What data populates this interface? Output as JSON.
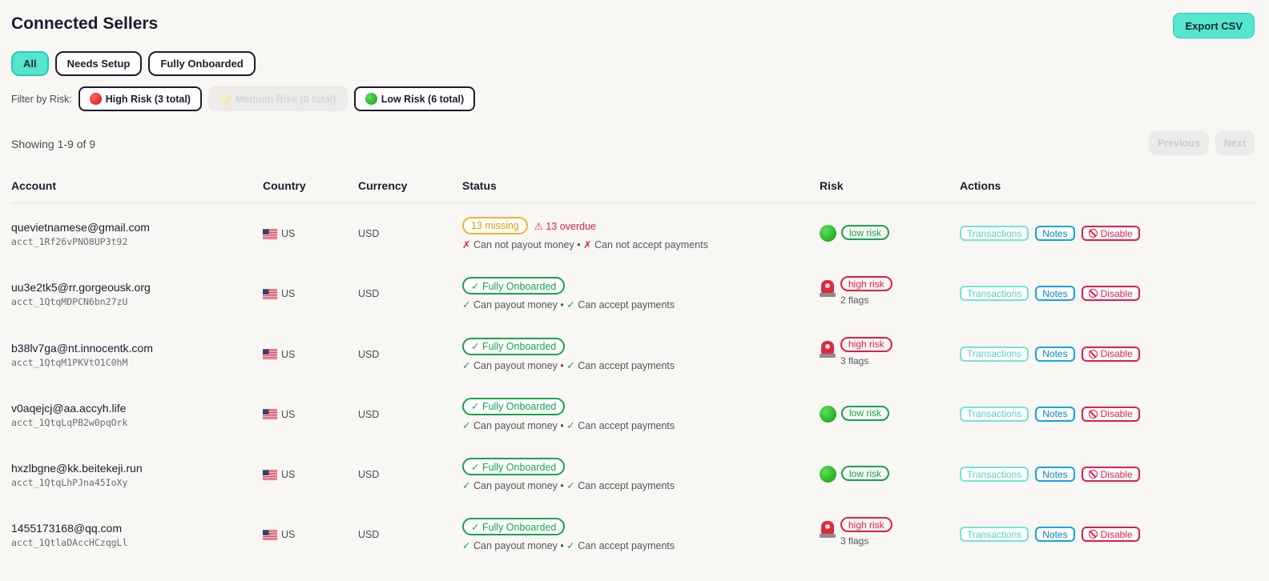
{
  "header": {
    "title": "Connected Sellers",
    "export_label": "Export CSV"
  },
  "tabs": [
    {
      "label": "All",
      "active": true
    },
    {
      "label": "Needs Setup",
      "active": false
    },
    {
      "label": "Fully Onboarded",
      "active": false
    }
  ],
  "risk_filter": {
    "label": "Filter by Risk:",
    "options": [
      {
        "label": "High Risk (3 total)",
        "icon": "red-circle-icon",
        "disabled": false
      },
      {
        "label": "Medium Risk (0 total)",
        "icon": "yellow-circle-icon",
        "disabled": true
      },
      {
        "label": "Low Risk (6 total)",
        "icon": "green-circle-icon",
        "disabled": false
      }
    ]
  },
  "pagination": {
    "showing": "Showing 1-9 of 9",
    "previous": "Previous",
    "next": "Next"
  },
  "table": {
    "headers": {
      "account": "Account",
      "country": "Country",
      "currency": "Currency",
      "status": "Status",
      "risk": "Risk",
      "actions": "Actions"
    },
    "actions": {
      "transactions": "Transactions",
      "notes": "Notes",
      "disable": "Disable"
    },
    "rows": [
      {
        "email": "quevietnamese@gmail.com",
        "acct": "acct_1Rf26vPNO8UP3t92",
        "country": "US",
        "currency": "USD",
        "status": {
          "type": "missing",
          "pill": "13 missing",
          "overdue": "⚠ 13 overdue",
          "payout_mark": "✗",
          "payout": "Can not payout money",
          "sep": "•",
          "accept_mark": "✗",
          "accept": "Can not accept payments"
        },
        "risk": {
          "level": "low",
          "label": "low risk",
          "flags": ""
        }
      },
      {
        "email": "uu3e2tk5@rr.gorgeousk.org",
        "acct": "acct_1QtqMDPCN6bn27zU",
        "country": "US",
        "currency": "USD",
        "status": {
          "type": "onboarded",
          "pill": "✓ Fully Onboarded",
          "overdue": "",
          "payout_mark": "✓",
          "payout": "Can payout money",
          "sep": "•",
          "accept_mark": "✓",
          "accept": "Can accept payments"
        },
        "risk": {
          "level": "high",
          "label": "high risk",
          "flags": "2 flags"
        }
      },
      {
        "email": "b38lv7ga@nt.innocentk.com",
        "acct": "acct_1QtqM1PKVtO1C0hM",
        "country": "US",
        "currency": "USD",
        "status": {
          "type": "onboarded",
          "pill": "✓ Fully Onboarded",
          "overdue": "",
          "payout_mark": "✓",
          "payout": "Can payout money",
          "sep": "•",
          "accept_mark": "✓",
          "accept": "Can accept payments"
        },
        "risk": {
          "level": "high",
          "label": "high risk",
          "flags": "3 flags"
        }
      },
      {
        "email": "v0aqejcj@aa.accyh.life",
        "acct": "acct_1QtqLqPB2w0pqOrk",
        "country": "US",
        "currency": "USD",
        "status": {
          "type": "onboarded",
          "pill": "✓ Fully Onboarded",
          "overdue": "",
          "payout_mark": "✓",
          "payout": "Can payout money",
          "sep": "•",
          "accept_mark": "✓",
          "accept": "Can accept payments"
        },
        "risk": {
          "level": "low",
          "label": "low risk",
          "flags": ""
        }
      },
      {
        "email": "hxzlbgne@kk.beitekeji.run",
        "acct": "acct_1QtqLhPJna45IoXy",
        "country": "US",
        "currency": "USD",
        "status": {
          "type": "onboarded",
          "pill": "✓ Fully Onboarded",
          "overdue": "",
          "payout_mark": "✓",
          "payout": "Can payout money",
          "sep": "•",
          "accept_mark": "✓",
          "accept": "Can accept payments"
        },
        "risk": {
          "level": "low",
          "label": "low risk",
          "flags": ""
        }
      },
      {
        "email": "1455173168@qq.com",
        "acct": "acct_1QtlaDAccHCzqgLl",
        "country": "US",
        "currency": "USD",
        "status": {
          "type": "onboarded",
          "pill": "✓ Fully Onboarded",
          "overdue": "",
          "payout_mark": "✓",
          "payout": "Can payout money",
          "sep": "•",
          "accept_mark": "✓",
          "accept": "Can accept payments"
        },
        "risk": {
          "level": "high",
          "label": "high risk",
          "flags": "3 flags"
        }
      }
    ]
  }
}
